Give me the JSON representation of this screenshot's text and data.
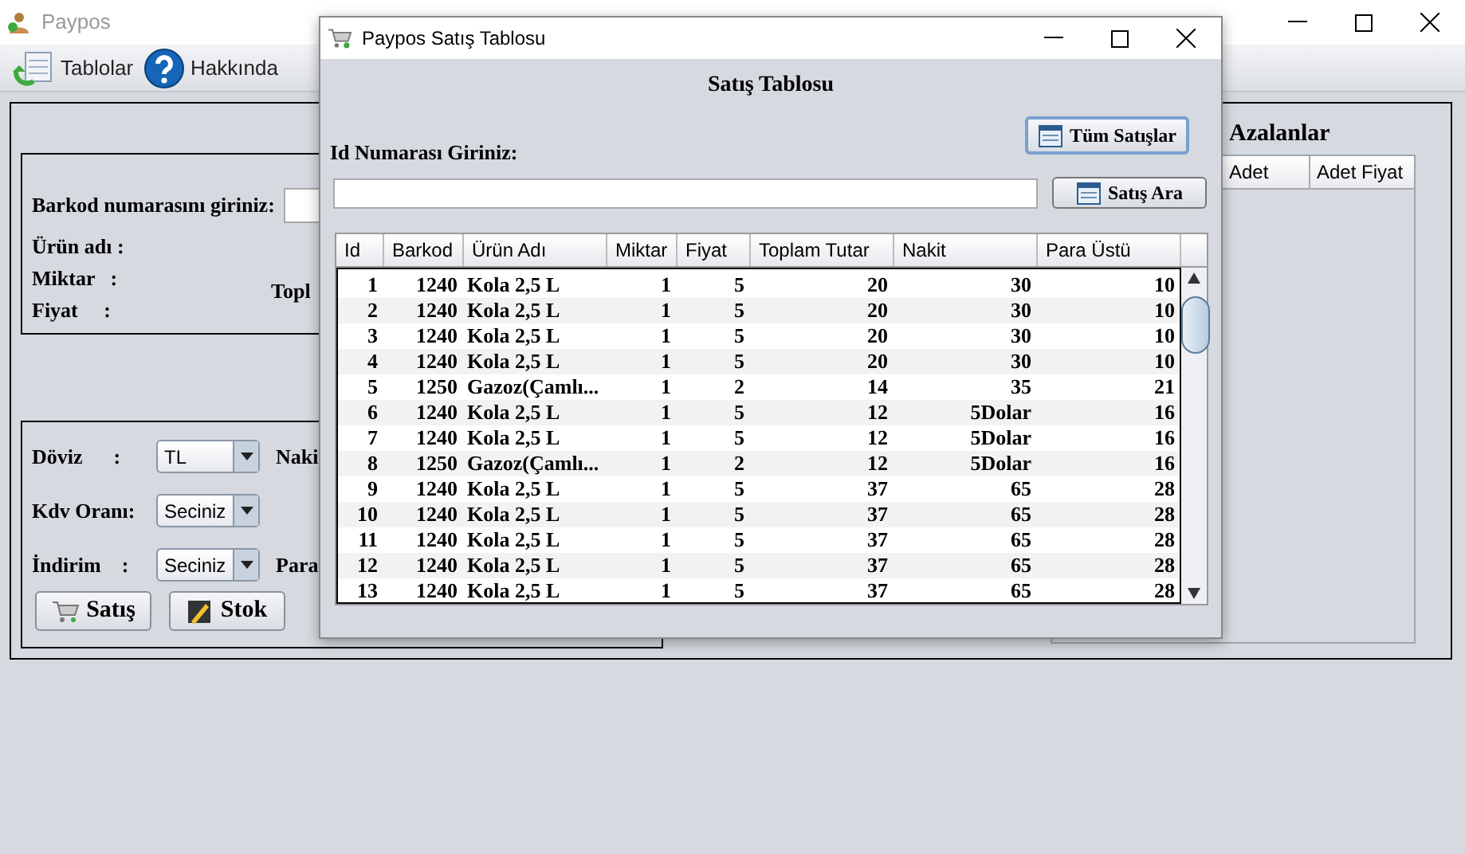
{
  "main_window": {
    "title": "Paypos",
    "toolbar": [
      {
        "kind": "tables",
        "label": "Tablolar"
      },
      {
        "kind": "help",
        "label": "Hakkında"
      }
    ],
    "product_panel": {
      "barcode_label": "Barkod numarasını giriniz:",
      "fields": [
        "Ürün adı :",
        "Miktar   :",
        "Fiyat     :"
      ],
      "side_label": "Topl"
    },
    "payment_panel": {
      "rows": [
        {
          "label": "Döviz      :",
          "value": "TL",
          "side_label": "Naki"
        },
        {
          "label": "Kdv Oranı:",
          "value": "Seciniz"
        },
        {
          "label": "İndirim    :",
          "value": "Seciniz",
          "side_label": "Para"
        }
      ],
      "buttons": [
        {
          "kind": "sale",
          "label": "Satış"
        },
        {
          "kind": "stock",
          "label": "Stok"
        }
      ]
    },
    "low_stock_panel": {
      "title": "Azalanlar",
      "columns": [
        "Adet",
        "Adet Fiyat"
      ]
    }
  },
  "dialog": {
    "title": "Paypos Satış Tablosu",
    "heading": "Satış Tablosu",
    "id_label": "Id Numarası Giriniz:",
    "buttons": [
      "Tüm Satışlar",
      "Satış Ara"
    ],
    "table": {
      "columns": [
        "Id",
        "Barkod",
        "Ürün Adı",
        "Miktar",
        "Fiyat",
        "Toplam Tutar",
        "Nakit",
        "Para Üstü"
      ],
      "rows": [
        [
          "1",
          "1240",
          "Kola 2,5 L",
          "1",
          "5",
          "20",
          "30",
          "10"
        ],
        [
          "2",
          "1240",
          "Kola 2,5 L",
          "1",
          "5",
          "20",
          "30",
          "10"
        ],
        [
          "3",
          "1240",
          "Kola 2,5 L",
          "1",
          "5",
          "20",
          "30",
          "10"
        ],
        [
          "4",
          "1240",
          "Kola 2,5 L",
          "1",
          "5",
          "20",
          "30",
          "10"
        ],
        [
          "5",
          "1250",
          "Gazoz(Çamlı...",
          "1",
          "2",
          "14",
          "35",
          "21"
        ],
        [
          "6",
          "1240",
          "Kola 2,5 L",
          "1",
          "5",
          "12",
          "5Dolar",
          "16"
        ],
        [
          "7",
          "1240",
          "Kola 2,5 L",
          "1",
          "5",
          "12",
          "5Dolar",
          "16"
        ],
        [
          "8",
          "1250",
          "Gazoz(Çamlı...",
          "1",
          "2",
          "12",
          "5Dolar",
          "16"
        ],
        [
          "9",
          "1240",
          "Kola 2,5 L",
          "1",
          "5",
          "37",
          "65",
          "28"
        ],
        [
          "10",
          "1240",
          "Kola 2,5 L",
          "1",
          "5",
          "37",
          "65",
          "28"
        ],
        [
          "11",
          "1240",
          "Kola 2,5 L",
          "1",
          "5",
          "37",
          "65",
          "28"
        ],
        [
          "12",
          "1240",
          "Kola 2,5 L",
          "1",
          "5",
          "37",
          "65",
          "28"
        ],
        [
          "13",
          "1240",
          "Kola 2,5 L",
          "1",
          "5",
          "37",
          "65",
          "28"
        ]
      ]
    }
  }
}
